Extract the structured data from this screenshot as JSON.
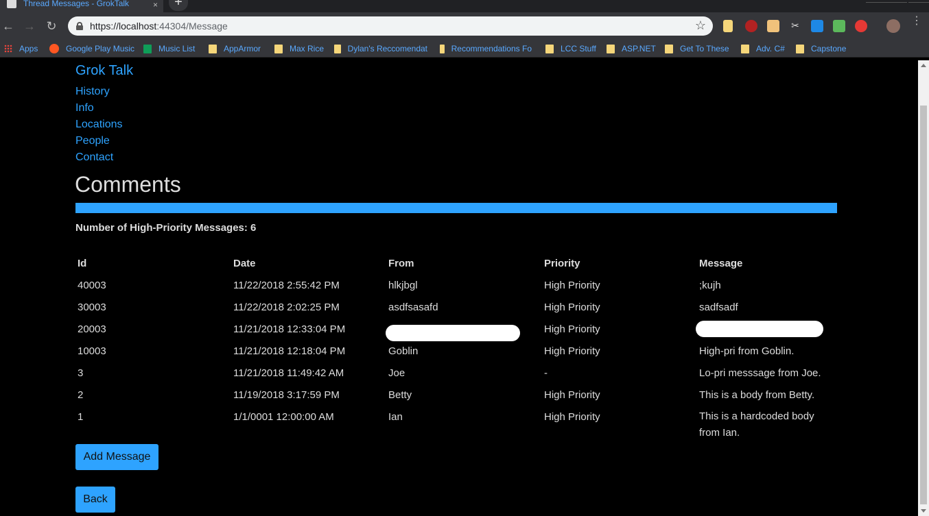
{
  "browser": {
    "tab_title": "Thread Messages - GrokTalk",
    "tab_close": "×",
    "new_tab": "+",
    "url_host": "https://localhost",
    "url_path": ":44304/Message",
    "bookmarks": [
      {
        "label": "Apps",
        "icon": "apps-grid-icon"
      },
      {
        "label": "Google Play Music",
        "icon": "play-music-icon"
      },
      {
        "label": "Music List",
        "icon": "sheets-icon"
      },
      {
        "label": "AppArmor",
        "icon": "folder-icon"
      },
      {
        "label": "Max Rice",
        "icon": "folder-icon"
      },
      {
        "label": "Dylan's Reccomendat",
        "icon": "folder-icon"
      },
      {
        "label": "Recommendations Fo",
        "icon": "folder-icon"
      },
      {
        "label": "LCC Stuff",
        "icon": "folder-icon"
      },
      {
        "label": "ASP.NET",
        "icon": "folder-icon"
      },
      {
        "label": "Get To These",
        "icon": "folder-icon"
      },
      {
        "label": "Adv. C#",
        "icon": "folder-icon"
      },
      {
        "label": "Capstone",
        "icon": "folder-icon"
      }
    ]
  },
  "site": {
    "brand": "Grok Talk",
    "nav": [
      "History",
      "Info",
      "Locations",
      "People",
      "Contact"
    ]
  },
  "main": {
    "title": "Comments",
    "high_priority_count_label": "Number of High-Priority Messages: 6",
    "table": {
      "headers": [
        "Id",
        "Date",
        "From",
        "Priority",
        "Message"
      ],
      "rows": [
        {
          "id": "40003",
          "date": "11/22/2018 2:55:42 PM",
          "from": "hlkjbgl",
          "priority": "High Priority",
          "message": ";kujh"
        },
        {
          "id": "30003",
          "date": "11/22/2018 2:02:25 PM",
          "from": "asdfsasafd",
          "priority": "High Priority",
          "message": "sadfsadf"
        },
        {
          "id": "20003",
          "date": "11/21/2018 12:33:04 PM",
          "from": "",
          "priority": "High Priority",
          "message": ""
        },
        {
          "id": "10003",
          "date": "11/21/2018 12:18:04 PM",
          "from": "Goblin",
          "priority": "High Priority",
          "message": "High-pri from Goblin."
        },
        {
          "id": "3",
          "date": "11/21/2018 11:49:42 AM",
          "from": "Joe",
          "priority": "-",
          "message": "Lo-pri messsage from Joe."
        },
        {
          "id": "2",
          "date": "11/19/2018 3:17:59 PM",
          "from": "Betty",
          "priority": "High Priority",
          "message": "This is a body from Betty."
        },
        {
          "id": "1",
          "date": "1/1/0001 12:00:00 AM",
          "from": "Ian",
          "priority": "High Priority",
          "message": "This is a hardcoded body from Ian."
        }
      ]
    },
    "add_button": "Add Message",
    "back_button": "Back"
  },
  "colors": {
    "accent": "#2ea3ff",
    "background": "#000000",
    "text": "#dddddd"
  }
}
